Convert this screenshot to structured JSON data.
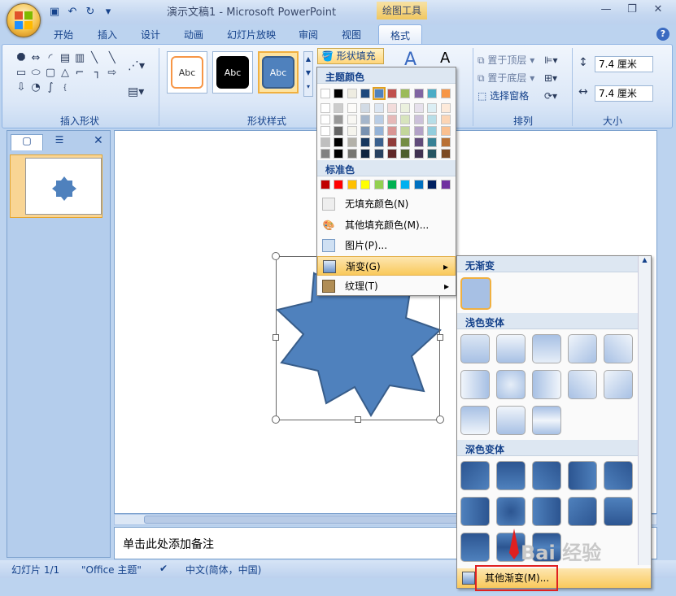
{
  "titlebar": {
    "doc_title": "演示文稿1 - Microsoft PowerPoint",
    "context_tab": "绘图工具"
  },
  "tabs": [
    "开始",
    "插入",
    "设计",
    "动画",
    "幻灯片放映",
    "审阅",
    "视图",
    "格式"
  ],
  "ribbon": {
    "groups": {
      "insert_shapes": "插入形状",
      "shape_styles": "形状样式",
      "arrange": "排列",
      "size": "大小"
    },
    "style_swatch_label": "Abc",
    "fill_button": "形状填充",
    "arrange_items": [
      "置于顶层",
      "置于底层",
      "选择窗格"
    ],
    "size_height": "7.4 厘米",
    "size_width": "7.4 厘米"
  },
  "fill_menu": {
    "theme_colors": "主题颜色",
    "standard_colors": "标准色",
    "items": {
      "no_fill": "无填充颜色(N)",
      "more_colors": "其他填充颜色(M)...",
      "picture": "图片(P)...",
      "gradient": "渐变(G)",
      "texture": "纹理(T)"
    },
    "theme_row": [
      "#ffffff",
      "#000000",
      "#eeece1",
      "#1f497d",
      "#4f81bd",
      "#c0504d",
      "#9bbb59",
      "#8064a2",
      "#4bacc6",
      "#f79646"
    ],
    "standard_row": [
      "#c00000",
      "#ff0000",
      "#ffc000",
      "#ffff00",
      "#92d050",
      "#00b050",
      "#00b0f0",
      "#0070c0",
      "#002060",
      "#7030a0"
    ]
  },
  "gradient_menu": {
    "no_gradient": "无渐变",
    "light_variants": "浅色变体",
    "dark_variants": "深色变体",
    "more": "其他渐变(M)..."
  },
  "slide_number": "1",
  "notes_placeholder": "单击此处添加备注",
  "status": {
    "slide": "幻灯片 1/1",
    "theme": "\"Office 主题\"",
    "language": "中文(简体，中国)"
  },
  "watermark": "Bai 经验"
}
